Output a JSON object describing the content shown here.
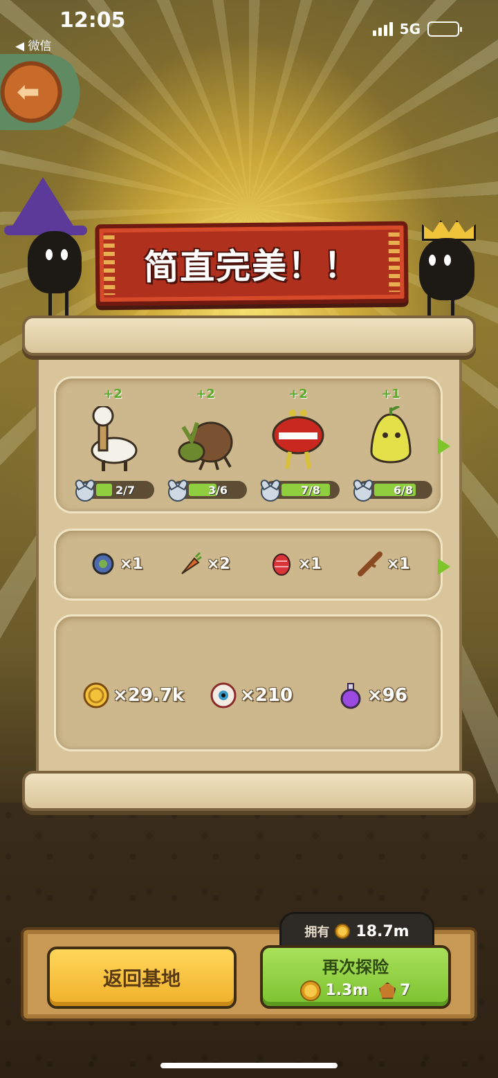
{
  "status_bar": {
    "time": "12:05",
    "back_app": "◀ 微信",
    "network": "5G"
  },
  "banner": {
    "title": "简直完美！！"
  },
  "monsters": [
    {
      "plus": "+2",
      "level_text": "2/7",
      "progress": 0.286,
      "icon": "alpaca-monster"
    },
    {
      "plus": "+2",
      "level_text": "3/6",
      "progress": 0.5,
      "icon": "hermit-crab-monster"
    },
    {
      "plus": "+2",
      "level_text": "7/8",
      "progress": 0.875,
      "icon": "lips-monster"
    },
    {
      "plus": "+1",
      "level_text": "6/8",
      "progress": 0.75,
      "icon": "pear-monster"
    }
  ],
  "items": [
    {
      "count": "×1",
      "icon": "snail-shell-icon"
    },
    {
      "count": "×2",
      "icon": "carrot-icon"
    },
    {
      "count": "×1",
      "icon": "red-egg-icon"
    },
    {
      "count": "×1",
      "icon": "wood-stick-icon"
    }
  ],
  "resources": [
    {
      "count": "×29.7k",
      "icon": "gold-coin-icon"
    },
    {
      "count": "×210",
      "icon": "eyeball-icon"
    },
    {
      "count": "×96",
      "icon": "purple-potion-icon"
    }
  ],
  "bottom": {
    "owned_label": "拥有",
    "owned_value": "18.7m",
    "return_label": "返回基地",
    "explore_label": "再次探险",
    "explore_coin_cost": "1.3m",
    "explore_ticket_cost": "7"
  },
  "colors": {
    "banner_red": "#b0301e",
    "progress_green": "#8fcf3f",
    "button_yellow": "#f0b02a",
    "button_green": "#7cc230"
  }
}
